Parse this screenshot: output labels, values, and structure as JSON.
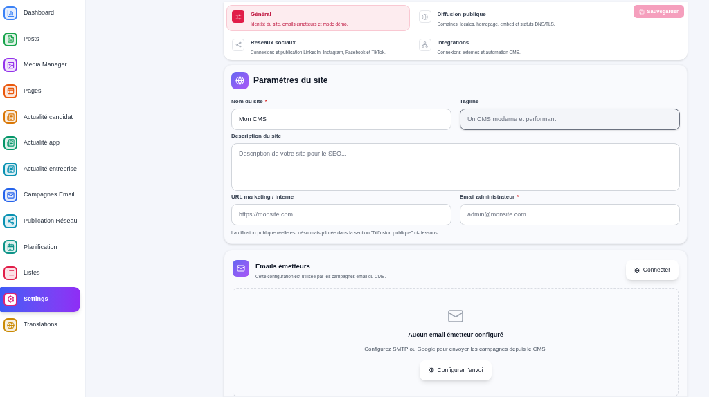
{
  "sidebar": {
    "items": [
      {
        "label": "Dashboard",
        "color": "#3b82f6",
        "selected": false
      },
      {
        "label": "Posts",
        "color": "#16a34a",
        "selected": false
      },
      {
        "label": "Media Manager",
        "color": "#9333ea",
        "selected": false
      },
      {
        "label": "Pages",
        "color": "#ea580c",
        "selected": false
      },
      {
        "label": "Actualité candidat",
        "color": "#d97706",
        "selected": false
      },
      {
        "label": "Actualité app",
        "color": "#059669",
        "selected": false
      },
      {
        "label": "Actualité entreprise",
        "color": "#0891b2",
        "selected": false
      },
      {
        "label": "Campagnes Email",
        "color": "#2563eb",
        "selected": false
      },
      {
        "label": "Publication Réseau",
        "color": "#0891b2",
        "selected": false
      },
      {
        "label": "Planification",
        "color": "#0d9488",
        "selected": false
      },
      {
        "label": "Listes",
        "color": "#e11d48",
        "selected": false
      },
      {
        "label": "Settings",
        "color": "#db2777",
        "selected": true
      },
      {
        "label": "Translations",
        "color": "#ca8a04",
        "selected": false
      }
    ]
  },
  "sections": [
    {
      "title": "Général",
      "description": "Identité du site, emails émetteurs et mode démo.",
      "selected": true
    },
    {
      "title": "Diffusion publique",
      "description": "Domaines, locales, homepage, embed et statuts DNS/TLS.",
      "selected": false
    },
    {
      "title": "Réseaux sociaux",
      "description": "Connexions et publication LinkedIn, Instagram, Facebook et TikTok.",
      "selected": false
    },
    {
      "title": "Intégrations",
      "description": "Connexions externes et automation CMS.",
      "selected": false
    }
  ],
  "save_button": {
    "label": "Sauvegarder",
    "disabled": true
  },
  "site_settings": {
    "title": "Paramètres du site",
    "fields": [
      {
        "label": "Nom du site",
        "required_mark": "*",
        "value": "Mon CMS",
        "focused": false,
        "kind": "input"
      },
      {
        "label": "Tagline",
        "placeholder": "Un CMS moderne et performant",
        "focused": true,
        "kind": "input"
      },
      {
        "label": "Description du site",
        "placeholder": "Description de votre site pour le SEO...",
        "focused": false,
        "kind": "textarea"
      },
      {
        "label": "URL marketing / interne",
        "placeholder": "https://monsite.com",
        "focused": false,
        "kind": "input"
      },
      {
        "label": "Email administrateur",
        "required_mark": "*",
        "placeholder": "admin@monsite.com",
        "focused": false,
        "kind": "input"
      }
    ],
    "note": "La diffusion publique réelle est désormais pilotée dans la section \"Diffusion publique\" ci-dessous."
  },
  "sender_emails": {
    "title": "Emails émetteurs",
    "subtitle": "Cette configuration est utilisée par les campagnes email du CMS.",
    "connect_button": "Connecter",
    "empty": {
      "title": "Aucun email émetteur configuré",
      "text": "Configurez SMTP ou Google pour envoyer les campagnes depuis le CMS.",
      "button": "Configurer l'envoi"
    }
  }
}
